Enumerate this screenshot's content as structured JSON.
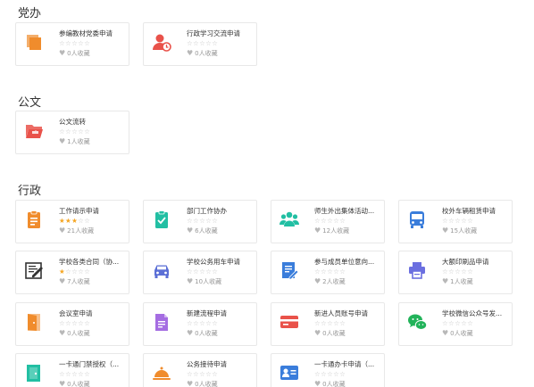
{
  "sections": [
    {
      "title": "党办"
    },
    {
      "title": "公文"
    },
    {
      "title": "行政"
    }
  ],
  "cards": [
    {
      "title": "参编教材党委申请",
      "rating": 0,
      "fav": "0人收藏",
      "icon": "copy-icon",
      "color": "#f08c2c"
    },
    {
      "title": "行政学习交流申请",
      "rating": 0,
      "fav": "0人收藏",
      "icon": "user-clock-icon",
      "color": "#e9524a"
    },
    {
      "title": "公文流转",
      "rating": 0,
      "fav": "1人收藏",
      "icon": "folder-open-icon",
      "color": "#e9524a"
    },
    {
      "title": "工作请示申请",
      "rating": 3,
      "fav": "21人收藏",
      "icon": "clipboard-icon",
      "color": "#f08c2c"
    },
    {
      "title": "部门工作协办",
      "rating": 0,
      "fav": "6人收藏",
      "icon": "clipboard-check-icon",
      "color": "#22bfa3"
    },
    {
      "title": "师生外出集体活动...",
      "rating": 0,
      "fav": "12人收藏",
      "icon": "users-icon",
      "color": "#22bfa3"
    },
    {
      "title": "校外车辆租赁申请",
      "rating": 0,
      "fav": "15人收藏",
      "icon": "bus-icon",
      "color": "#3a7ddb"
    },
    {
      "title": "学校各类合同（协...",
      "rating": 1,
      "fav": "7人收藏",
      "icon": "contract-icon",
      "color": "#333333"
    },
    {
      "title": "学校公务用车申请",
      "rating": 0,
      "fav": "10人收藏",
      "icon": "car-icon",
      "color": "#5b6fd6"
    },
    {
      "title": "参与成员单位意向...",
      "rating": 0,
      "fav": "2人收藏",
      "icon": "edit-doc-icon",
      "color": "#3a7ddb"
    },
    {
      "title": "大额印刷品申请",
      "rating": 0,
      "fav": "1人收藏",
      "icon": "printer-icon",
      "color": "#6b6fe0"
    },
    {
      "title": "会议室申请",
      "rating": 0,
      "fav": "0人收藏",
      "icon": "door-icon",
      "color": "#f08c2c"
    },
    {
      "title": "新建流程申请",
      "rating": 0,
      "fav": "0人收藏",
      "icon": "new-doc-icon",
      "color": "#a56de2"
    },
    {
      "title": "新进人员账号申请",
      "rating": 0,
      "fav": "0人收藏",
      "icon": "credit-card-icon",
      "color": "#e9524a"
    },
    {
      "title": "学校微信公众号发...",
      "rating": 0,
      "fav": "0人收藏",
      "icon": "wechat-icon",
      "color": "#22b35a"
    },
    {
      "title": "一卡通门禁授权（...",
      "rating": 0,
      "fav": "0人收藏",
      "icon": "door-access-icon",
      "color": "#22bfa3"
    },
    {
      "title": "公务接待申请",
      "rating": 0,
      "fav": "0人收藏",
      "icon": "cloche-icon",
      "color": "#f08c2c"
    },
    {
      "title": "一卡通办卡申请（...",
      "rating": 0,
      "fav": "0人收藏",
      "icon": "id-card-icon",
      "color": "#3a7ddb"
    }
  ]
}
